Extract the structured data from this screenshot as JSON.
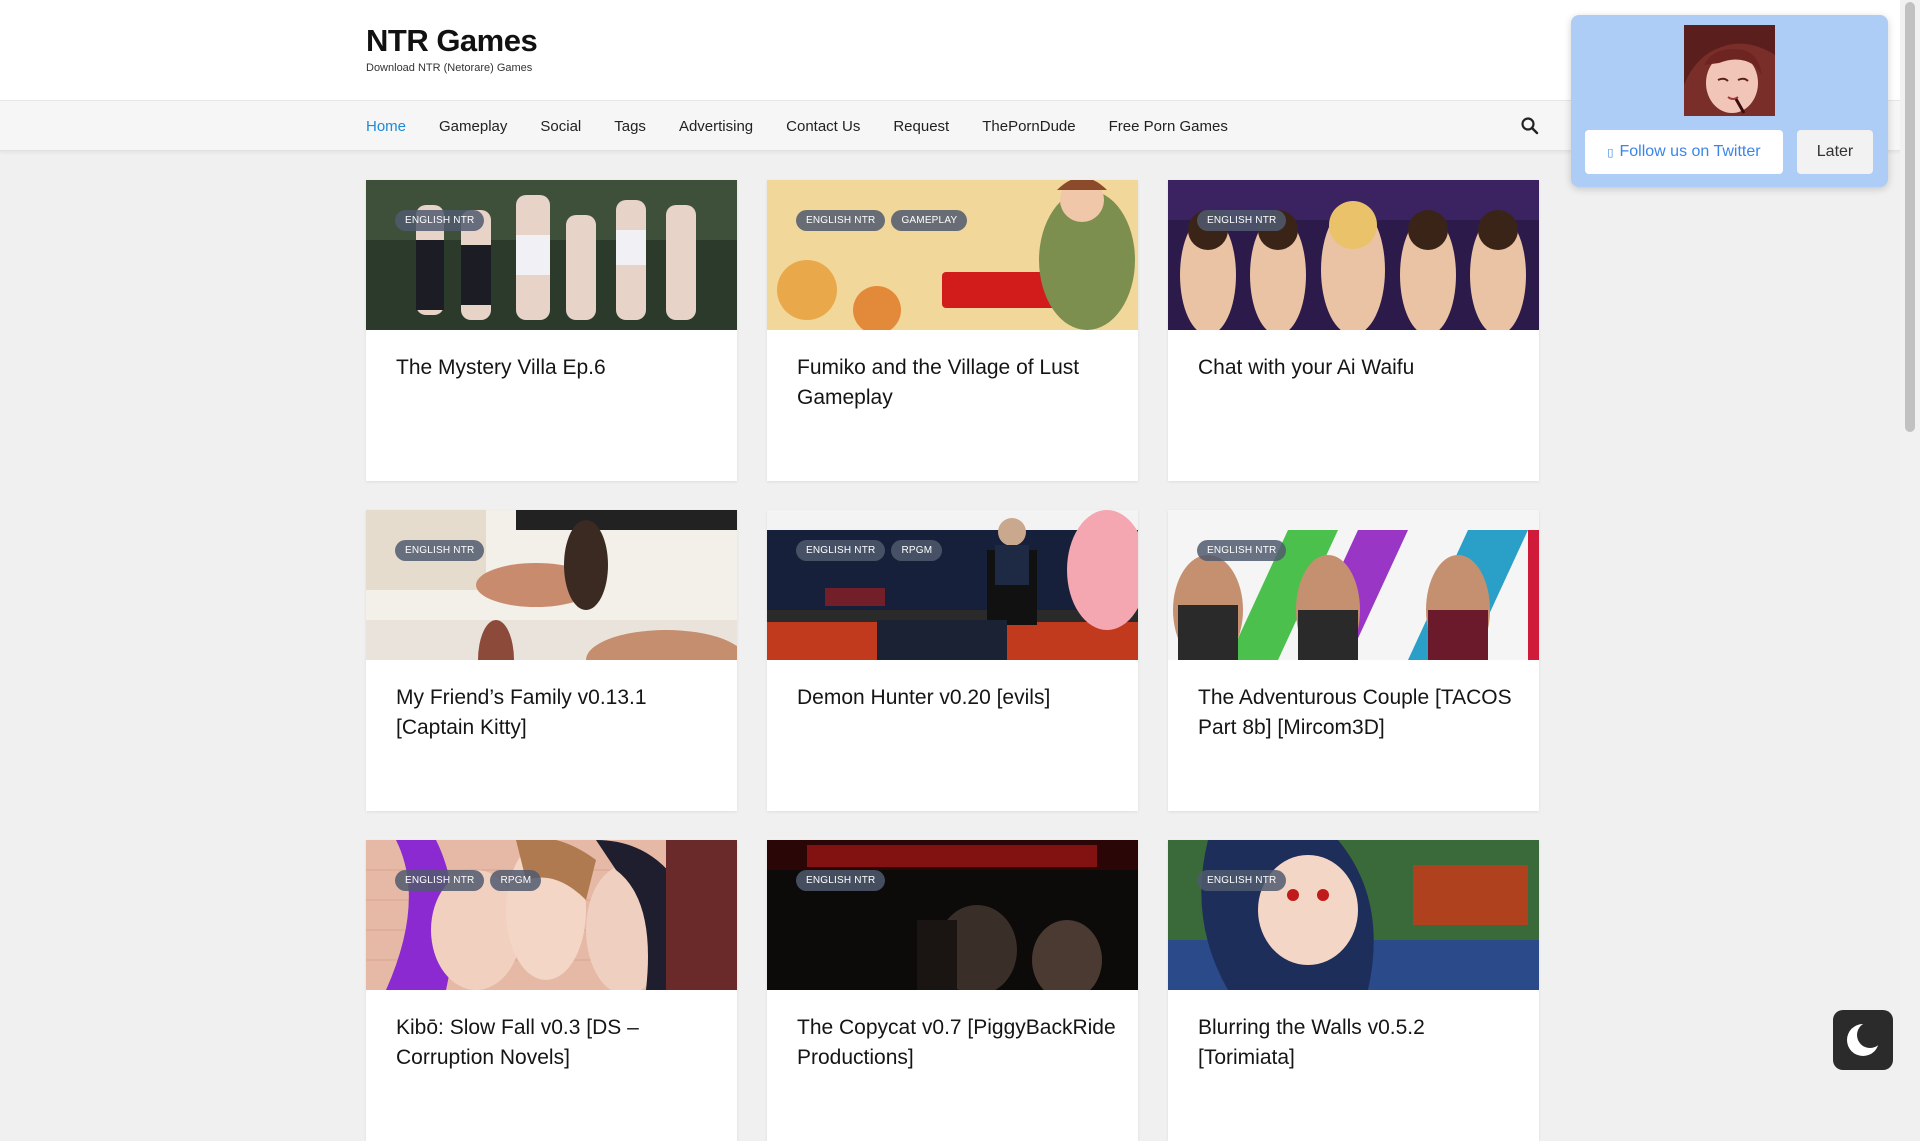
{
  "site": {
    "title": "NTR Games",
    "tagline": "Download NTR (Netorare) Games"
  },
  "nav": {
    "items": [
      {
        "label": "Home",
        "active": true
      },
      {
        "label": "Gameplay"
      },
      {
        "label": "Social"
      },
      {
        "label": "Tags"
      },
      {
        "label": "Advertising"
      },
      {
        "label": "Contact Us"
      },
      {
        "label": "Request"
      },
      {
        "label": "ThePornDude"
      },
      {
        "label": "Free Porn Games"
      }
    ],
    "search_icon": "search-icon"
  },
  "posts": [
    {
      "title": "The Mystery Villa Ep.6",
      "tags": [
        "English NTR"
      ]
    },
    {
      "title": "Fumiko and the Village of Lust Gameplay",
      "tags": [
        "English NTR",
        "Gameplay"
      ]
    },
    {
      "title": "Chat with your Ai Waifu",
      "tags": [
        "English NTR"
      ]
    },
    {
      "title": "My Friend’s Family v0.13.1 [Captain Kitty]",
      "tags": [
        "English NTR"
      ]
    },
    {
      "title": "Demon Hunter v0.20 [evils]",
      "tags": [
        "English NTR",
        "RPGM"
      ]
    },
    {
      "title": "The Adventurous Couple [TACOS Part 8b] [Mircom3D]",
      "tags": [
        "English NTR"
      ]
    },
    {
      "title": "Kibō: Slow Fall v0.3 [DS – Corruption Novels]",
      "tags": [
        "English NTR",
        "RPGM"
      ]
    },
    {
      "title": "The Copycat v0.7 [PiggyBackRide Productions]",
      "tags": [
        "English NTR"
      ]
    },
    {
      "title": "Blurring the Walls v0.5.2 [Torimiata]",
      "tags": [
        "English NTR"
      ]
    }
  ],
  "popup": {
    "follow_label": "Follow us on Twitter",
    "later_label": "Later"
  },
  "colors": {
    "accent": "#1e8ad6",
    "popup_bg": "#aecdf6",
    "tag_bg": "#505a6e"
  }
}
